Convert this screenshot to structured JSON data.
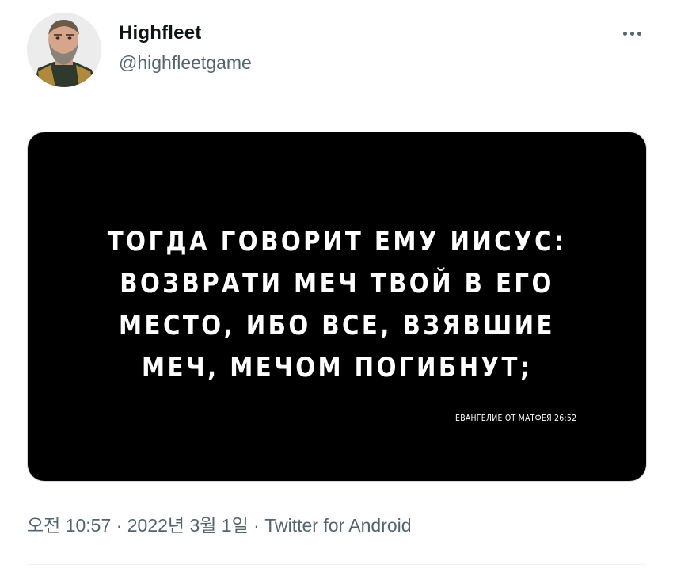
{
  "tweet": {
    "display_name": "Highfleet",
    "handle": "@highfleetgame",
    "more_icon": "more-horizontal-icon",
    "media": {
      "quote_lines": [
        "ТОГДА ГОВОРИТ ЕМУ ИИСУС:",
        "ВОЗВРАТИ МЕЧ ТВОЙ В ЕГО",
        "МЕСТО, ИБО ВСЕ, ВЗЯВШИЕ",
        "МЕЧ, МЕЧОМ ПОГИБНУТ;"
      ],
      "source": "ЕВАНГЕЛИЕ ОТ МАТФЕЯ 26:52"
    },
    "meta": {
      "time": "오전 10:57",
      "separator": " · ",
      "date": "2022년 3월 1일",
      "client": "Twitter for Android"
    }
  },
  "colors": {
    "text_primary": "#0f1419",
    "text_secondary": "#536471",
    "media_background": "#000000",
    "media_text": "#ffffff"
  }
}
